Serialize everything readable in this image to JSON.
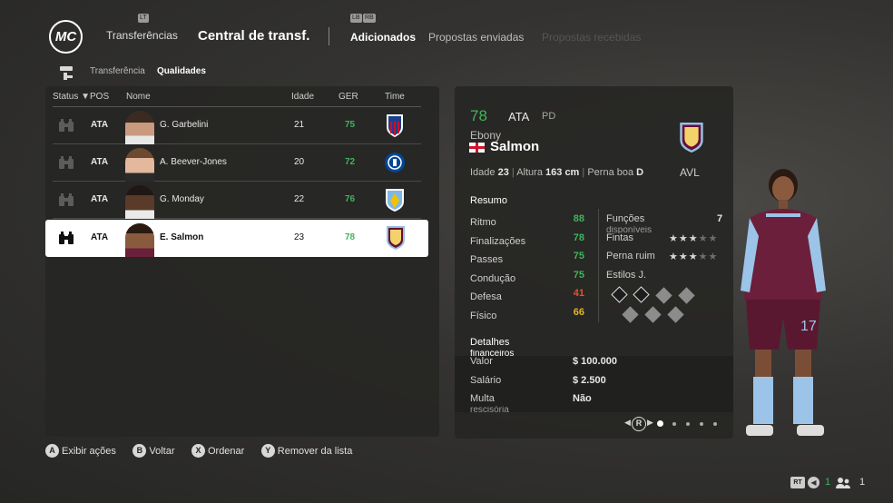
{
  "header": {
    "logo_text": "MC",
    "lb_hint": "LT",
    "tabs_hint_left": "LB",
    "tabs_hint_right": "RB",
    "section_label": "Transferências",
    "title": "Central de transf.",
    "tabs": [
      {
        "label": "Adicionados",
        "state": "active"
      },
      {
        "label": "Propostas enviadas",
        "state": "inactive"
      },
      {
        "label": "Propostas recebidas",
        "state": "disabled"
      }
    ]
  },
  "subtabs": [
    {
      "label": "Transferência",
      "active": false
    },
    {
      "label": "Qualidades",
      "active": true
    }
  ],
  "list": {
    "columns": {
      "status": "Status",
      "pos": "POS",
      "name": "Nome",
      "age": "Idade",
      "ovr": "GER",
      "club": "Time"
    },
    "rows": [
      {
        "pos": "ATA",
        "name": "G. Garbelini",
        "age": "21",
        "ovr": "75",
        "club_icon": "atletico-madrid-crest",
        "selected": false
      },
      {
        "pos": "ATA",
        "name": "A. Beever-Jones",
        "age": "20",
        "ovr": "72",
        "club_icon": "chelsea-crest",
        "selected": false
      },
      {
        "pos": "ATA",
        "name": "G. Monday",
        "age": "22",
        "ovr": "76",
        "club_icon": "blue-crest",
        "selected": false
      },
      {
        "pos": "ATA",
        "name": "E. Salmon",
        "age": "23",
        "ovr": "78",
        "club_icon": "aston-villa-crest",
        "selected": true
      }
    ]
  },
  "player": {
    "ovr": "78",
    "position": "ATA",
    "alt_position": "PD",
    "first_name": "Ebony",
    "last_name": "Salmon",
    "club_abbr": "AVL",
    "age_label": "Idade",
    "age": "23",
    "height_label": "Altura",
    "height": "163 cm",
    "foot_label": "Perna boa",
    "foot": "D",
    "summary_title": "Resumo",
    "stats": [
      {
        "label": "Ritmo",
        "value": "88",
        "color": "#3fb55a"
      },
      {
        "label": "Finalizações",
        "value": "78",
        "color": "#3fb55a"
      },
      {
        "label": "Passes",
        "value": "75",
        "color": "#3fb55a"
      },
      {
        "label": "Condução",
        "value": "75",
        "color": "#3fb55a"
      },
      {
        "label": "Defesa",
        "value": "41",
        "color": "#e0532b"
      },
      {
        "label": "Físico",
        "value": "66",
        "color": "#e6b422"
      }
    ],
    "functions_label": "Funções",
    "functions_sub": "disponíveis",
    "functions_value": "7",
    "skill_label": "Fintas",
    "skill_stars": 3,
    "weak_foot_label": "Perna ruim",
    "weak_foot_stars": 3,
    "playstyles_label": "Estilos J.",
    "financial_title": "Detalhes",
    "financial_sub": "financeiros",
    "value_label": "Valor",
    "value": "$ 100.000",
    "wage_label": "Salário",
    "wage": "$ 2.500",
    "clause_label": "Multa",
    "clause_sub": "rescisória",
    "clause": "Não",
    "shirt_number": "17"
  },
  "pager": {
    "button": "R"
  },
  "footer": {
    "actions": [
      {
        "btn": "A",
        "label": "Exibir ações"
      },
      {
        "btn": "B",
        "label": "Voltar"
      },
      {
        "btn": "X",
        "label": "Ordenar"
      },
      {
        "btn": "Y",
        "label": "Remover da lista"
      }
    ],
    "rt_label": "RT",
    "count_a": "1",
    "count_b": "1"
  }
}
